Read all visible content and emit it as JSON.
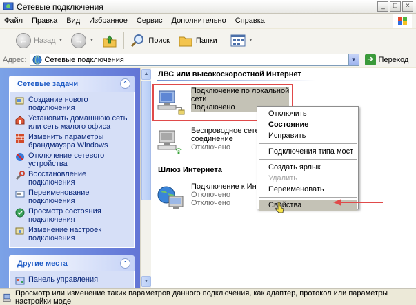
{
  "window": {
    "title": "Сетевые подключения",
    "buttons": {
      "minimize": "_",
      "maximize": "□",
      "close": "×"
    }
  },
  "menubar": {
    "items": [
      "Файл",
      "Правка",
      "Вид",
      "Избранное",
      "Сервис",
      "Дополнительно",
      "Справка"
    ]
  },
  "toolbar": {
    "back_label": "Назад",
    "search_label": "Поиск",
    "folders_label": "Папки"
  },
  "address": {
    "label": "Адрес:",
    "value": "Сетевые подключения",
    "go_label": "Переход"
  },
  "tasks_panel": {
    "title": "Сетевые задачи",
    "items": [
      {
        "label": "Создание нового подключения",
        "icon": "new-connection-icon"
      },
      {
        "label": "Установить домашнюю сеть или сеть малого офиса",
        "icon": "home-network-icon"
      },
      {
        "label": "Изменить параметры брандмауэра Windows",
        "icon": "firewall-icon"
      },
      {
        "label": "Отключение сетевого устройства",
        "icon": "disable-network-icon"
      },
      {
        "label": "Восстановление подключения",
        "icon": "repair-icon"
      },
      {
        "label": "Переименование подключения",
        "icon": "rename-icon"
      },
      {
        "label": "Просмотр состояния подключения",
        "icon": "status-icon"
      },
      {
        "label": "Изменение настроек подключения",
        "icon": "settings-icon"
      }
    ]
  },
  "other_places_panel": {
    "title": "Другие места",
    "items": [
      {
        "label": "Панель управления",
        "icon": "control-panel-icon"
      }
    ]
  },
  "groups": [
    {
      "title": "ЛВС или высокоскоростной Интернет",
      "connections": [
        {
          "name_line1": "Подключение по локальной",
          "name_line2": "сети",
          "status": "Подключено",
          "selected": true
        },
        {
          "name_line1": "Беспроводное сетевое",
          "name_line2": "соединение",
          "status": "Отключено",
          "selected": false
        }
      ]
    },
    {
      "title": "Шлюз Интернета",
      "connections": [
        {
          "name_line1": "Подключение к Интернету",
          "name_line2": "Отключено",
          "status": "Отключено",
          "selected": false
        }
      ]
    }
  ],
  "context_menu": {
    "items": [
      {
        "label": "Отключить",
        "style": "normal"
      },
      {
        "label": "Состояние",
        "style": "bold"
      },
      {
        "label": "Исправить",
        "style": "normal"
      },
      {
        "separator": true
      },
      {
        "label": "Подключения типа мост",
        "style": "normal"
      },
      {
        "separator": true
      },
      {
        "label": "Создать ярлык",
        "style": "normal"
      },
      {
        "label": "Удалить",
        "style": "disabled"
      },
      {
        "label": "Переименовать",
        "style": "normal"
      },
      {
        "separator": true
      },
      {
        "label": "Свойства",
        "style": "highlight"
      }
    ]
  },
  "statusbar": {
    "text": "Просмотр или изменение таких параметров данного подключения, как адаптер, протокол или параметры настройки моде"
  },
  "colors": {
    "highlight_red": "#e04a4a",
    "task_link": "#0c297b",
    "panel_head_text": "#215dc6"
  }
}
